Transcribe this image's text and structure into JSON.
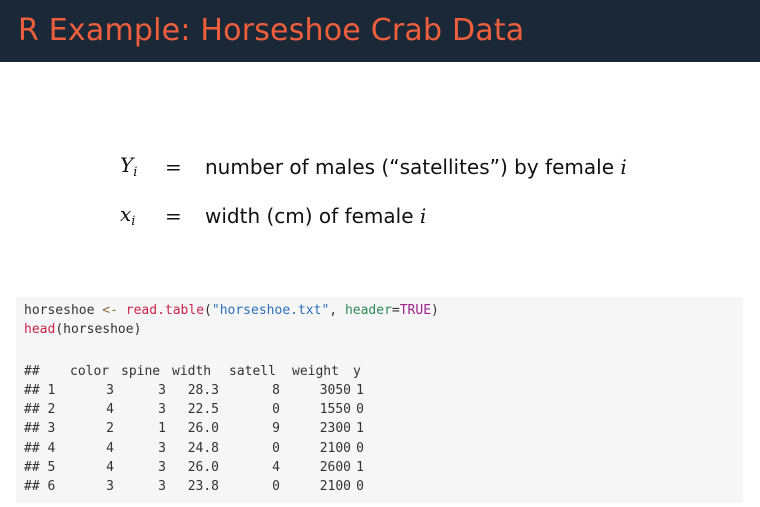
{
  "slide": {
    "title": "R Example: Horseshoe Crab Data"
  },
  "equations": [
    {
      "symbol": "Y",
      "subscript": "i",
      "equals": "=",
      "text_before": "number of males (“satellites”) by female",
      "var": "i"
    },
    {
      "symbol": "x",
      "subscript": "i",
      "equals": "=",
      "text_before": "width (cm) of female",
      "var": "i"
    }
  ],
  "code": {
    "line1": {
      "var": "horseshoe",
      "assign": " <- ",
      "fn": "read.table",
      "open": "(",
      "str": "\"horseshoe.txt\"",
      "comma": ", ",
      "arg": "header",
      "eq": "=",
      "kw": "TRUE",
      "close": ")"
    },
    "line2": {
      "fn": "head",
      "arg": "(horseshoe)"
    }
  },
  "output": {
    "prefix": "##",
    "columns": [
      "color",
      "spine",
      "width",
      "satell",
      "weight",
      "y"
    ],
    "rows": [
      {
        "prefix": "## 1",
        "values": [
          "3",
          "3",
          "28.3",
          "8",
          "3050",
          "1"
        ]
      },
      {
        "prefix": "## 2",
        "values": [
          "4",
          "3",
          "22.5",
          "0",
          "1550",
          "0"
        ]
      },
      {
        "prefix": "## 3",
        "values": [
          "2",
          "1",
          "26.0",
          "9",
          "2300",
          "1"
        ]
      },
      {
        "prefix": "## 4",
        "values": [
          "4",
          "3",
          "24.8",
          "0",
          "2100",
          "0"
        ]
      },
      {
        "prefix": "## 5",
        "values": [
          "4",
          "3",
          "26.0",
          "4",
          "2600",
          "1"
        ]
      },
      {
        "prefix": "## 6",
        "values": [
          "3",
          "3",
          "23.8",
          "0",
          "2100",
          "0"
        ]
      }
    ]
  },
  "colors": {
    "title_bar": "#1b2838",
    "title_text": "#f05f3c",
    "code_background": "#f6f6f6"
  }
}
